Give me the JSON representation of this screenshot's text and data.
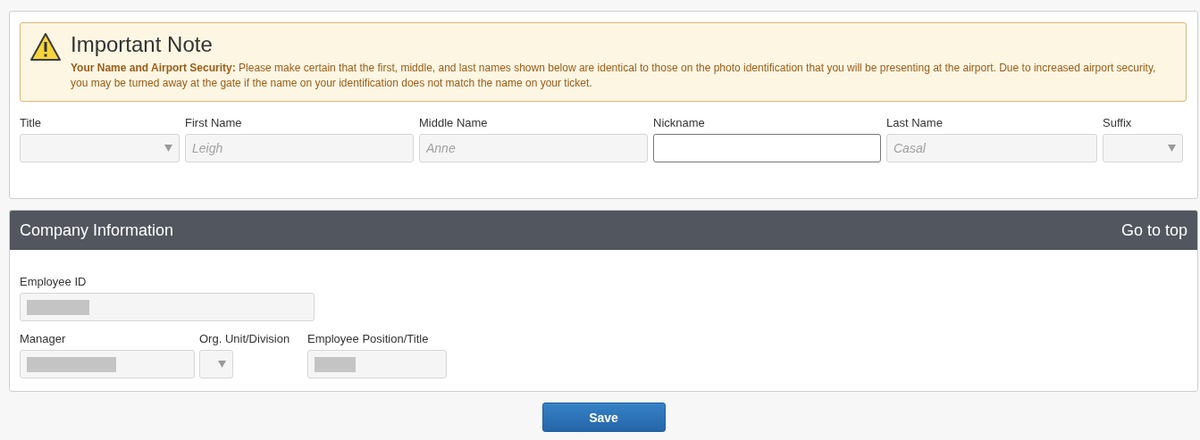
{
  "note": {
    "title": "Important Note",
    "text": "**Your Name and Airport Security:** Please make certain that the first, middle, and last names shown below are identical to those on the photo identification that you will be presenting at the airport. Due to increased airport security, you may be turned away at the gate if the name on your identification does not match the name on your ticket."
  },
  "name_fields": [
    {
      "label": "Title",
      "kind": "select",
      "disabled": true
    },
    {
      "label": "First Name",
      "kind": "text",
      "placeholder": "Leigh",
      "disabled": true
    },
    {
      "label": "Middle Name",
      "kind": "text",
      "placeholder": "Anne",
      "disabled": true
    },
    {
      "label": "Nickname",
      "kind": "text",
      "disabled": false
    },
    {
      "label": "Last Name",
      "kind": "text",
      "placeholder": "Casal",
      "disabled": true
    },
    {
      "label": "Suffix",
      "kind": "select",
      "disabled": true
    }
  ],
  "company": {
    "title": "Company Information",
    "link": "Go to top",
    "fields": [
      {
        "label": "Employee ID",
        "kind": "text",
        "disabled": true,
        "redacted": true
      },
      {
        "label": "Manager",
        "kind": "text",
        "disabled": true,
        "redacted": true
      },
      {
        "label": "Org. Unit/Division",
        "kind": "select",
        "disabled": true
      },
      {
        "label": "Employee Position/Title",
        "kind": "text",
        "disabled": true,
        "redacted": true
      }
    ]
  },
  "buttons": [
    {
      "label": "Save"
    }
  ]
}
